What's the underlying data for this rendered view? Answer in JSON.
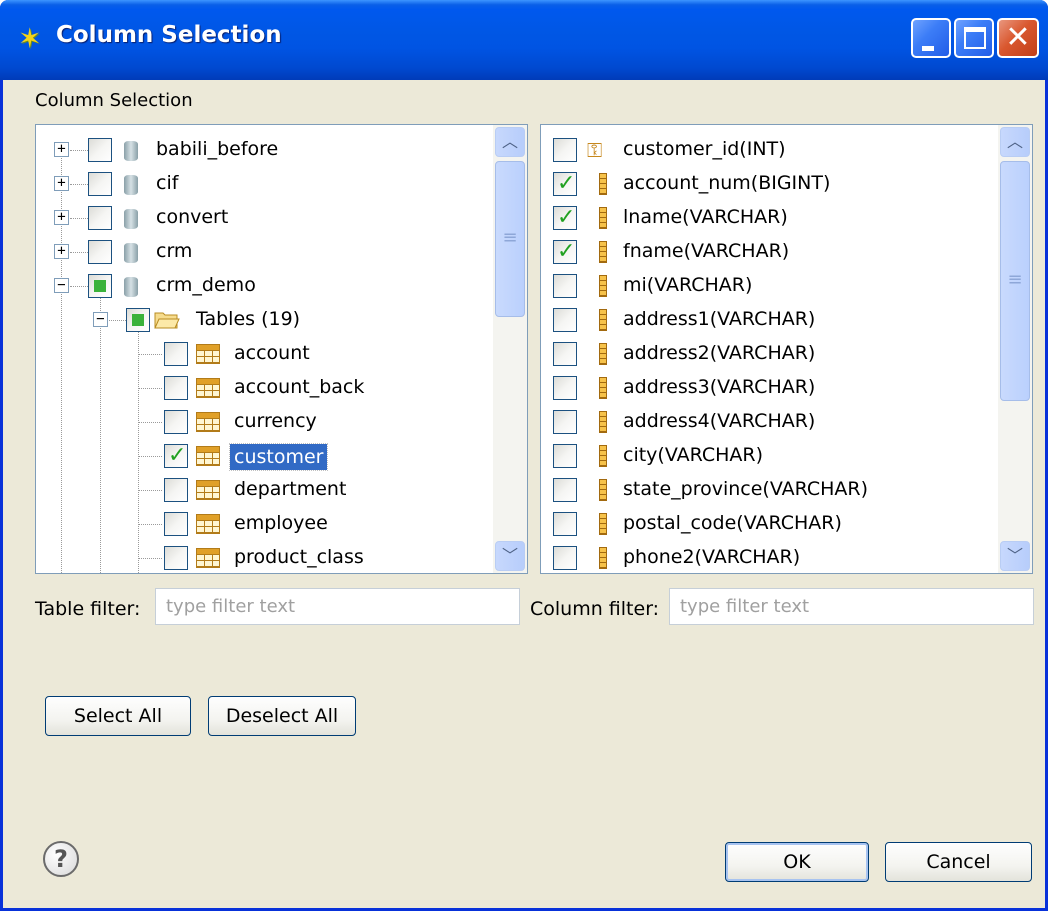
{
  "window": {
    "title": "Column Selection"
  },
  "section_label": "Column Selection",
  "tables_tree": [
    {
      "label": "babili_before",
      "level": 0,
      "expander": "+",
      "check": "none",
      "icon": "database-icon"
    },
    {
      "label": "cif",
      "level": 0,
      "expander": "+",
      "check": "none",
      "icon": "database-icon"
    },
    {
      "label": "convert",
      "level": 0,
      "expander": "+",
      "check": "none",
      "icon": "database-icon"
    },
    {
      "label": "crm",
      "level": 0,
      "expander": "+",
      "check": "none",
      "icon": "database-icon"
    },
    {
      "label": "crm_demo",
      "level": 0,
      "expander": "−",
      "check": "partial",
      "icon": "database-icon"
    },
    {
      "label": "Tables (19)",
      "level": 1,
      "expander": "−",
      "check": "partial",
      "icon": "folder-icon"
    },
    {
      "label": "account",
      "level": 2,
      "check": "none",
      "icon": "table-icon"
    },
    {
      "label": "account_back",
      "level": 2,
      "check": "none",
      "icon": "table-icon"
    },
    {
      "label": "currency",
      "level": 2,
      "check": "none",
      "icon": "table-icon"
    },
    {
      "label": "customer",
      "level": 2,
      "check": "checked",
      "icon": "table-icon",
      "selected": true
    },
    {
      "label": "department",
      "level": 2,
      "check": "none",
      "icon": "table-icon"
    },
    {
      "label": "employee",
      "level": 2,
      "check": "none",
      "icon": "table-icon"
    },
    {
      "label": "product_class",
      "level": 2,
      "check": "none",
      "icon": "table-icon"
    }
  ],
  "columns_list": [
    {
      "label": "customer_id(INT)",
      "check": "none",
      "icon": "key-icon"
    },
    {
      "label": "account_num(BIGINT)",
      "check": "checked",
      "icon": "column-icon"
    },
    {
      "label": "lname(VARCHAR)",
      "check": "checked",
      "icon": "column-icon"
    },
    {
      "label": "fname(VARCHAR)",
      "check": "checked",
      "icon": "column-icon"
    },
    {
      "label": "mi(VARCHAR)",
      "check": "none",
      "icon": "column-icon"
    },
    {
      "label": "address1(VARCHAR)",
      "check": "none",
      "icon": "column-icon"
    },
    {
      "label": "address2(VARCHAR)",
      "check": "none",
      "icon": "column-icon"
    },
    {
      "label": "address3(VARCHAR)",
      "check": "none",
      "icon": "column-icon"
    },
    {
      "label": "address4(VARCHAR)",
      "check": "none",
      "icon": "column-icon"
    },
    {
      "label": "city(VARCHAR)",
      "check": "none",
      "icon": "column-icon"
    },
    {
      "label": "state_province(VARCHAR)",
      "check": "none",
      "icon": "column-icon"
    },
    {
      "label": "postal_code(VARCHAR)",
      "check": "none",
      "icon": "column-icon"
    },
    {
      "label": "phone2(VARCHAR)",
      "check": "none",
      "icon": "column-icon"
    }
  ],
  "filters": {
    "table_label": "Table filter:",
    "table_placeholder": "type filter text",
    "column_label": "Column filter:",
    "column_placeholder": "type filter text"
  },
  "buttons": {
    "select_all": "Select All",
    "deselect_all": "Deselect All",
    "ok": "OK",
    "cancel": "Cancel",
    "help": "?"
  },
  "colors": {
    "titlebar": "#0054e3",
    "dialog_bg": "#ece9d8",
    "selection": "#316ac5",
    "check_green": "#21a121"
  }
}
